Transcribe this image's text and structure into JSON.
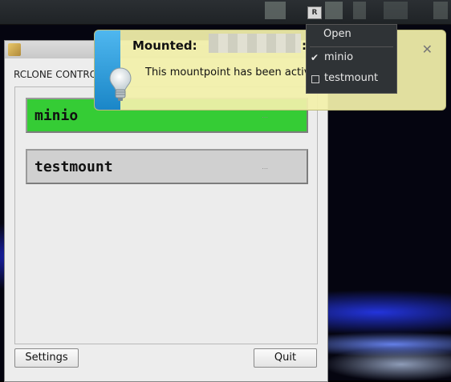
{
  "panel": {
    "tray_badge": "R"
  },
  "window": {
    "label": "RCLONE CONTRO",
    "mounts": [
      {
        "label": "minio",
        "dots": "...",
        "status_color": "#35cc35"
      },
      {
        "label": "testmount",
        "dots": "..."
      }
    ],
    "settings_label": "Settings",
    "quit_label": "Quit"
  },
  "notification": {
    "title": "Mounted:",
    "colon": ":",
    "body": "This mountpoint has been activ",
    "close_icon": "close-icon"
  },
  "tray_menu": {
    "open_label": "Open",
    "items": [
      {
        "label": "minio",
        "checked": true
      },
      {
        "label": "testmount",
        "checked": false
      }
    ]
  },
  "colors": {
    "mounted_green": "#35cc35",
    "notification_bg": "#f2f0aa",
    "stripe_blue": "#1a86c7"
  }
}
